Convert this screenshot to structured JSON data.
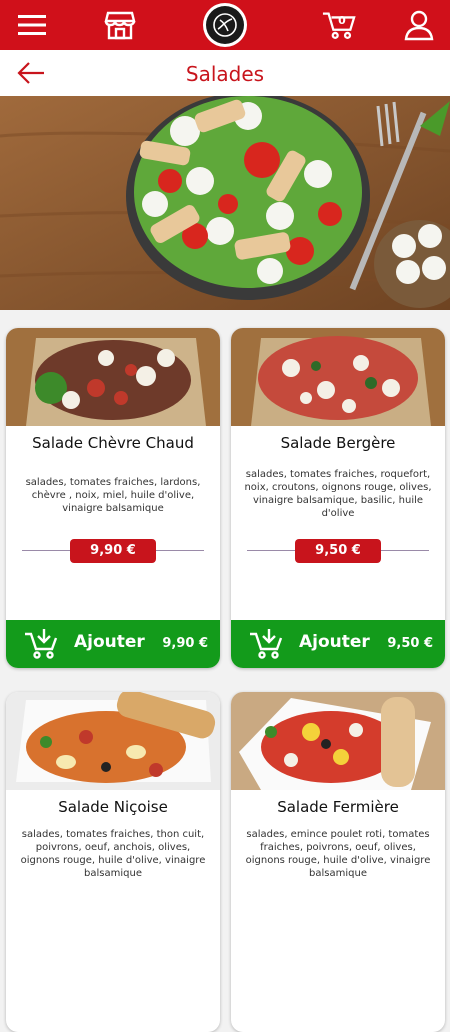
{
  "header": {
    "cart_count": "0"
  },
  "title_bar": {
    "title": "Salades"
  },
  "products": [
    {
      "name": "Salade Chèvre Chaud",
      "description": "salades, tomates fraiches, lardons, chèvre , noix, miel, huile d'olive, vinaigre balsamique",
      "price": "9,90 €",
      "add_label": "Ajouter",
      "add_price": "9,90 €"
    },
    {
      "name": "Salade Bergère",
      "description": "salades, tomates fraiches, roquefort, noix, croutons, oignons rouge, olives, vinaigre balsamique, basilic, huile d'olive",
      "price": "9,50 €",
      "add_label": "Ajouter",
      "add_price": "9,50 €"
    },
    {
      "name": "Salade Niçoise",
      "description": "salades, tomates fraiches, thon cuit, poivrons, oeuf, anchois, olives, oignons rouge, huile d'olive, vinaigre balsamique"
    },
    {
      "name": "Salade Fermière",
      "description": "salades, emince poulet roti, tomates fraiches, poivrons, oeuf, olives, oignons rouge, huile d'olive, vinaigre balsamique"
    }
  ],
  "colors": {
    "brand_red": "#d0101a",
    "add_green": "#139b1b",
    "title_red": "#c8141c"
  },
  "icons": [
    "menu-icon",
    "store-icon",
    "logo",
    "cart-icon",
    "user-icon",
    "back-arrow-icon",
    "add-cart-icon"
  ]
}
